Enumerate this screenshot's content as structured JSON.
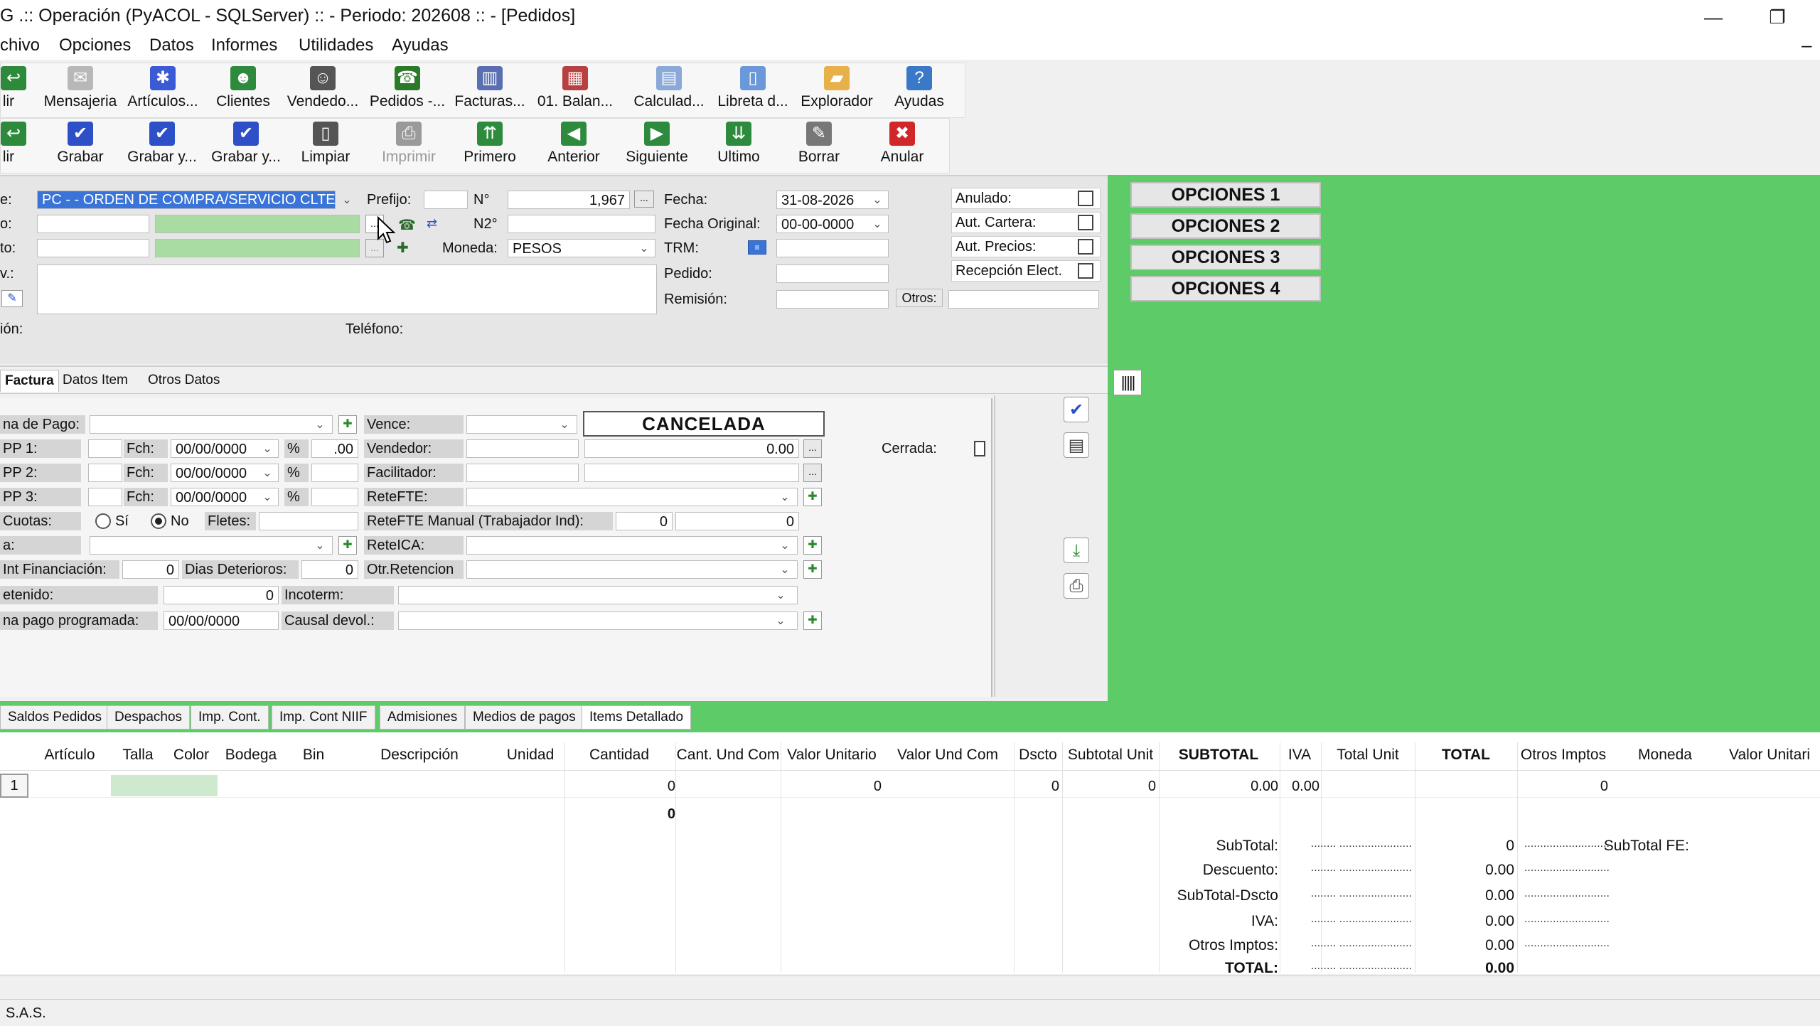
{
  "window": {
    "title": "G .:: Operación (PyACOL - SQLServer) :: - Periodo: 202608 :: - [Pedidos]",
    "minimize": "—",
    "restore": "❐",
    "inner_minimize": "–"
  },
  "menu": [
    "chivo",
    "Opciones",
    "Datos",
    "Informes",
    "Utilidades",
    "Ayudas"
  ],
  "toolbar1": [
    {
      "label": "lir",
      "icon": "exit-icon",
      "color": "#2c8a3a"
    },
    {
      "label": "Mensajeria",
      "icon": "mail-icon",
      "color": "#b8b8b8"
    },
    {
      "label": "Artículos...",
      "icon": "articles-icon",
      "color": "#3b5bd6"
    },
    {
      "label": "Clientes",
      "icon": "clients-icon",
      "color": "#2e8b3d"
    },
    {
      "label": "Vendedo...",
      "icon": "seller-icon",
      "color": "#555555"
    },
    {
      "label": "Pedidos -...",
      "icon": "phone-icon",
      "color": "#2a7a2a"
    },
    {
      "label": "Facturas...",
      "icon": "invoices-icon",
      "color": "#5a6fb0"
    },
    {
      "label": "01. Balan...",
      "icon": "balance-icon",
      "color": "#b84040"
    },
    {
      "label": "Calculad...",
      "icon": "calculator-icon",
      "color": "#8aa8d8"
    },
    {
      "label": "Libreta d...",
      "icon": "notebook-icon",
      "color": "#6a98d8"
    },
    {
      "label": "Explorador",
      "icon": "folder-icon",
      "color": "#e8b048"
    },
    {
      "label": "Ayudas",
      "icon": "help-icon",
      "color": "#3a78c8"
    }
  ],
  "toolbar2": [
    {
      "label": "lir",
      "icon": "exit-icon",
      "color": "#2c8a3a"
    },
    {
      "label": "Grabar",
      "icon": "save-check-icon",
      "color": "#2d4fc7"
    },
    {
      "label": "Grabar y...",
      "icon": "save-new-icon",
      "color": "#2d4fc7"
    },
    {
      "label": "Grabar y...",
      "icon": "save-close-icon",
      "color": "#2d4fc7"
    },
    {
      "label": "Limpiar",
      "icon": "clear-icon",
      "color": "#555555"
    },
    {
      "label": "Imprimir",
      "icon": "print-icon",
      "color": "#9a9a9a"
    },
    {
      "label": "Primero",
      "icon": "first-icon",
      "color": "#2e8b3d"
    },
    {
      "label": "Anterior",
      "icon": "previous-icon",
      "color": "#2e8b3d"
    },
    {
      "label": "Siguiente",
      "icon": "next-icon",
      "color": "#2e8b3d"
    },
    {
      "label": "Ultimo",
      "icon": "last-icon",
      "color": "#2e8b3d"
    },
    {
      "label": "Borrar",
      "icon": "delete-icon",
      "color": "#777777"
    },
    {
      "label": "Anular",
      "icon": "cancel-icon",
      "color": "#d02828"
    }
  ],
  "header": {
    "tipo_label": "e:",
    "tipo_value": "PC - - ORDEN DE COMPRA/SERVICIO CLTE",
    "row2_label": "o:",
    "row3_label": "to:",
    "row4_label": "v.:",
    "prefijo_label": "Prefijo:",
    "n_label": "N°",
    "n_value": "1,967",
    "n2_label": "N2°",
    "moneda_label": "Moneda:",
    "moneda_value": "PESOS",
    "fecha_label": "Fecha:",
    "fecha_value": "31-08-2026",
    "fecha_orig_label": "Fecha Original:",
    "fecha_orig_value": "00-00-0000",
    "trm_label": "TRM:",
    "pedido_label": "Pedido:",
    "remision_label": "Remisión:",
    "otros_label": "Otros:",
    "anulado_label": "Anulado:",
    "aut_cartera_label": "Aut. Cartera:",
    "aut_precios_label": "Aut. Precios:",
    "recepcion_label": "Recepción Elect.",
    "ion_label": "ión:",
    "telefono_label": "Teléfono:",
    "ellipsis": "..."
  },
  "opciones": [
    "OPCIONES 1",
    "OPCIONES 2",
    "OPCIONES 3",
    "OPCIONES 4"
  ],
  "tabs_top": [
    "Factura",
    "Datos Item",
    "Otros Datos"
  ],
  "form": {
    "forma_pago": "na de Pago:",
    "pp1": "PP 1:",
    "pp2": "PP 2:",
    "pp3": "PP 3:",
    "fch": "Fch:",
    "date_empty": "00/00/0000",
    "pct": "%",
    "pp1_pct": ".00",
    "cuotas": "Cuotas:",
    "si": "Sí",
    "no": "No",
    "fletes": "Fletes:",
    "a_label": "a:",
    "int_fin": "Int Financiación:",
    "int_fin_val": "0",
    "dias_det": "Dias Deterioros:",
    "dias_det_val": "0",
    "retenido": "etenido:",
    "retenido_val": "0",
    "fecha_pago": "na pago programada:",
    "fecha_pago_val": "00/00/0000",
    "vence": "Vence:",
    "vendedor": "Vendedor:",
    "vendedor_val": "0.00",
    "facilitador": "Facilitador:",
    "retefte": "ReteFTE:",
    "retefte_manual": "ReteFTE Manual (Trabajador Ind):",
    "retefte_manual_a": "0",
    "retefte_manual_b": "0",
    "reteica": "ReteICA:",
    "otr_ret": "Otr.Retencion",
    "incoterm": "Incoterm:",
    "causal": "Causal devol.:",
    "cancelada": "CANCELADA",
    "cerrada": "Cerrada:"
  },
  "bottom_tabs": [
    "Saldos Pedidos",
    "Despachos",
    "Imp. Cont.",
    "Imp. Cont NIIF",
    "Admisiones",
    "Medios de pagos",
    "Items Detallado"
  ],
  "grid": {
    "headers": [
      "Artículo",
      "Talla",
      "Color",
      "Bodega",
      "Bin",
      "Descripción",
      "Unidad",
      "Cantidad",
      "Cant. Und Com",
      "Valor Unitario",
      "Valor Und Com",
      "Dscto",
      "Subtotal Unit",
      "SUBTOTAL",
      "IVA",
      "Total Unit",
      "TOTAL",
      "Otros Imptos",
      "Moneda",
      "Valor Unitari"
    ],
    "row_num": "1",
    "cantidad": "0",
    "valor_unitario": "0",
    "dscto": "0",
    "subtotal_unit": "0",
    "subtotal": "0.00",
    "iva": "0.00",
    "otros_imptos": "0",
    "sum_cantidad": "0"
  },
  "totals": [
    {
      "label": "SubTotal:",
      "value": "0"
    },
    {
      "label": "Descuento:",
      "value": "0.00"
    },
    {
      "label": "SubTotal-Dscto",
      "value": "0.00"
    },
    {
      "label": "IVA:",
      "value": "0.00"
    },
    {
      "label": "Otros Imptos:",
      "value": "0.00"
    },
    {
      "label": "TOTAL:",
      "value": "0.00"
    }
  ],
  "totals_dots": "........ .......................",
  "totals_dots2": "...........................",
  "subtotal_fe": "SubTotal FE:",
  "status": "S.A.S."
}
